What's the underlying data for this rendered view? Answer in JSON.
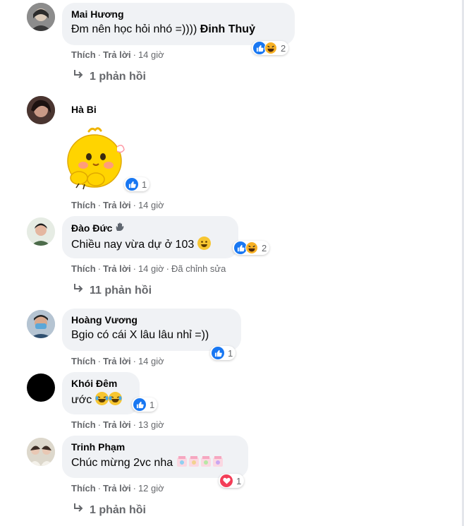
{
  "comments": [
    {
      "name": "Mai Hương",
      "text": "Đm nên học hỏi nhó =))))",
      "mention": "Đinh Thuỷ",
      "reaction_count": "2",
      "actions": {
        "like": "Thích",
        "reply": "Trả lời",
        "time": "14 giờ"
      },
      "replies_link": "1 phản hồi"
    },
    {
      "name": "Hà Bi",
      "reaction_count": "1",
      "actions": {
        "like": "Thích",
        "reply": "Trả lời",
        "time": "14 giờ"
      }
    },
    {
      "name": "Đào Đức",
      "text": "Chiều nay vừa dự ở 103",
      "reaction_count": "2",
      "actions": {
        "like": "Thích",
        "reply": "Trả lời",
        "time": "14 giờ",
        "edited": "Đã chỉnh sửa"
      },
      "replies_link": "11 phản hồi"
    },
    {
      "name": "Hoàng Vương",
      "text": "Bgio có cái X lâu lâu nhỉ =))",
      "reaction_count": "1",
      "actions": {
        "like": "Thích",
        "reply": "Trả lời",
        "time": "14 giờ"
      }
    },
    {
      "name": "Khói Đêm",
      "text": "ước",
      "reaction_count": "1",
      "actions": {
        "like": "Thích",
        "reply": "Trả lời",
        "time": "13 giờ"
      }
    },
    {
      "name": "Trinh Phạm",
      "text": "Chúc mừng 2vc nha",
      "reaction_count": "1",
      "actions": {
        "like": "Thích",
        "reply": "Trả lời",
        "time": "12 giờ"
      },
      "replies_link": "1 phản hồi"
    }
  ],
  "icons": {
    "like": "like-reaction-icon",
    "haha": "haha-reaction-icon",
    "love": "love-reaction-icon",
    "reply_arrow": "reply-arrow-icon",
    "badge": "wave-badge-icon"
  },
  "colors": {
    "bubble": "#f0f2f5",
    "meta_text": "#65676b",
    "like_blue": "#1877f2",
    "haha_yellow": "#f7b125",
    "love_red": "#f33e58"
  }
}
